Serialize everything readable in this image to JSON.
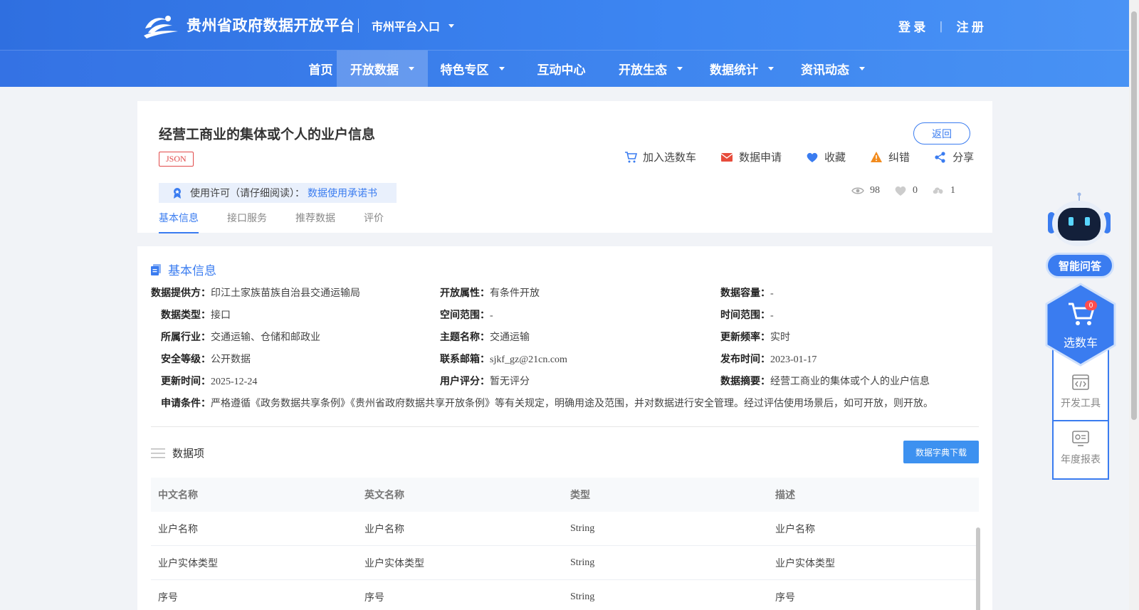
{
  "header": {
    "site_title": "贵州省政府数据开放平台",
    "city_entry": "市州平台入口",
    "login": "登 录",
    "separator": "|",
    "register": "注 册"
  },
  "nav": {
    "items": [
      {
        "label": "首页",
        "has_dropdown": false,
        "active": false
      },
      {
        "label": "开放数据",
        "has_dropdown": true,
        "active": true
      },
      {
        "label": "特色专区",
        "has_dropdown": true,
        "active": false
      },
      {
        "label": "互动中心",
        "has_dropdown": false,
        "active": false
      },
      {
        "label": "开放生态",
        "has_dropdown": true,
        "active": false
      },
      {
        "label": "数据统计",
        "has_dropdown": true,
        "active": false
      },
      {
        "label": "资讯动态",
        "has_dropdown": true,
        "active": false
      }
    ]
  },
  "dataset": {
    "title": "经营工商业的集体或个人的业户信息",
    "format_badge": "JSON",
    "back_label": "返回",
    "actions": {
      "add_cart": "加入选数车",
      "apply": "数据申请",
      "favorite": "收藏",
      "report_error": "纠错",
      "share": "分享"
    },
    "license": {
      "label": "使用许可（请仔细阅读）：",
      "link": "数据使用承诺书"
    },
    "stats": {
      "views": "98",
      "likes": "0",
      "downloads": "1"
    },
    "tabs": [
      "基本信息",
      "接口服务",
      "推荐数据",
      "评价"
    ]
  },
  "basic_info": {
    "section_title": "基本信息",
    "fields": {
      "provider": {
        "label": "数据提供方：",
        "value": "印江土家族苗族自治县交通运输局"
      },
      "open_attr": {
        "label": "开放属性：",
        "value": "有条件开放"
      },
      "capacity": {
        "label": "数据容量：",
        "value": "-"
      },
      "data_type": {
        "label": "数据类型：",
        "value": "接口"
      },
      "space_range": {
        "label": "空间范围：",
        "value": "-"
      },
      "time_range": {
        "label": "时间范围：",
        "value": "-"
      },
      "industry": {
        "label": "所属行业：",
        "value": "交通运输、仓储和邮政业"
      },
      "theme": {
        "label": "主题名称：",
        "value": "交通运输"
      },
      "update_freq": {
        "label": "更新频率：",
        "value": "实时"
      },
      "security": {
        "label": "安全等级：",
        "value": "公开数据"
      },
      "email": {
        "label": "联系邮箱：",
        "value": "sjkf_gz@21cn.com"
      },
      "publish_time": {
        "label": "发布时间：",
        "value": "2023-01-17"
      },
      "update_time": {
        "label": "更新时间：",
        "value": "2025-12-24"
      },
      "rating": {
        "label": "用户评分：",
        "value": "暂无评分"
      },
      "summary": {
        "label": "数据摘要：",
        "value": "经营工商业的集体或个人的业户信息"
      },
      "conditions": {
        "label": "申请条件：",
        "value": "严格遵循《政务数据共享条例》《贵州省政府数据共享开放条例》等有关规定，明确用途及范围，并对数据进行安全管理。经过评估使用场景后，如可开放，则开放。"
      }
    }
  },
  "data_items": {
    "title": "数据项",
    "download_label": "数据字典下载",
    "columns": [
      "中文名称",
      "英文名称",
      "类型",
      "描述"
    ],
    "rows": [
      [
        "业户名称",
        "业户名称",
        "String",
        "业户名称"
      ],
      [
        "业户实体类型",
        "业户实体类型",
        "String",
        "业户实体类型"
      ],
      [
        "序号",
        "序号",
        "String",
        "序号"
      ]
    ]
  },
  "side_tools": {
    "qa": "智能问答",
    "cart": "选数车",
    "cart_count": "0",
    "dev_tools": "开发工具",
    "annual_report": "年度报表"
  },
  "colors": {
    "primary": "#3a7cf0",
    "header_start": "#2f6fe0",
    "header_end": "#4a93f5",
    "badge_red": "#e14a4a"
  }
}
